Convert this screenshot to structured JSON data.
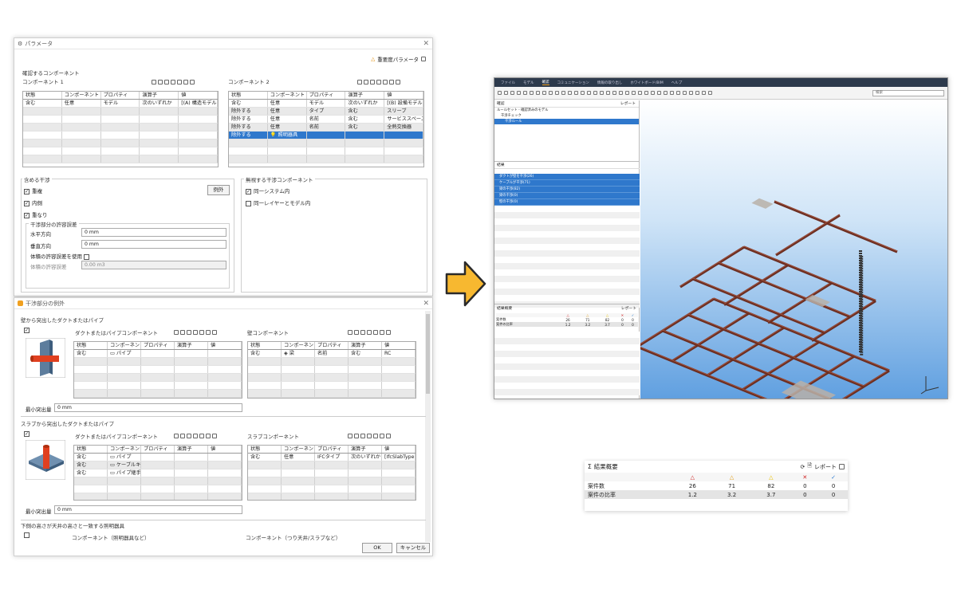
{
  "win1": {
    "title": "パラメータ",
    "priority_link": "重要度パラメータ",
    "sec_components": "確認するコンポーネント",
    "comp1_label": "コンポーネント 1",
    "comp2_label": "コンポーネント 2",
    "columns": [
      "状態",
      "コンポーネント",
      "プロパティ",
      "演算子",
      "値"
    ],
    "comp1_rows": [
      [
        "含む",
        "任意",
        "モデル",
        "次のいずれか",
        "[(A) 構造モデル]"
      ]
    ],
    "comp2_rows": [
      [
        "含む",
        "任意",
        "モデル",
        "次のいずれか",
        "[(B) 設備モデル]"
      ],
      [
        "除外する",
        "任意",
        "タイプ",
        "含む",
        "スリーブ"
      ],
      [
        "除外する",
        "任意",
        "名前",
        "含む",
        "サービススペース"
      ],
      [
        "除外する",
        "任意",
        "名前",
        "含む",
        "全熱交換器"
      ],
      [
        "除外する",
        "照明器具",
        "",
        "",
        ""
      ]
    ],
    "sec_interference": "含める干渉",
    "exception_button": "例外",
    "checks": [
      "重複",
      "内側",
      "重なり"
    ],
    "tolerance_group": "干渉部分の許容誤差",
    "horizontal_label": "水平方向",
    "horizontal_value": "0 mm",
    "vertical_label": "垂直方向",
    "vertical_value": "0 mm",
    "volume_check_label": "体積の許容誤差を使用",
    "volume_label": "体積の許容誤差",
    "volume_value": "0.00 m3",
    "sec_ignore": "無視する干渉コンポーネント",
    "ignore_checks": [
      "同一システム内",
      "同一レイヤーとモデル内"
    ]
  },
  "win2": {
    "title": "干渉部分の例外",
    "sec1": "壁から突出したダクトまたはパイプ",
    "duct_comp_label": "ダクトまたはパイプコンポーネント",
    "wall_comp_label": "壁コンポーネント",
    "columns": [
      "状態",
      "コンポーネント",
      "プロパティ",
      "演算子",
      "値"
    ],
    "duct_rows1": [
      [
        "含む",
        "パイプ",
        "",
        "",
        ""
      ]
    ],
    "wall_rows": [
      [
        "含む",
        "梁",
        "名前",
        "含む",
        "RC"
      ]
    ],
    "min_label": "最小突出量",
    "min_value": "0 mm",
    "sec2": "スラブから突出したダクトまたはパイプ",
    "slab_comp_label": "スラブコンポーネント",
    "duct_rows2": [
      [
        "含む",
        "パイプ",
        "",
        "",
        ""
      ],
      [
        "含む",
        "ケーブルキ...",
        "",
        "",
        ""
      ],
      [
        "含む",
        "パイプ継手",
        "",
        "",
        ""
      ]
    ],
    "slab_rows": [
      [
        "含む",
        "任意",
        "IFCタイプ",
        "次のいずれか",
        "[IfcSlabType]"
      ]
    ],
    "min_value2": "0 mm",
    "sec3": "下側の高さが天井の高さと一致する照明器具",
    "light_comp_label": "コンポーネント（照明器具など）",
    "ceiling_comp_label": "コンポーネント（つり天井/スラブなど）",
    "ok": "OK",
    "cancel": "キャンセル"
  },
  "app": {
    "menu": [
      "ファイル",
      "モデル",
      "確認",
      "コミュニケーション",
      "情報の取り出し",
      "ホワイトボード/BIM",
      "ヘルプ"
    ],
    "search_placeholder": "検索",
    "check_panel_title": "確認",
    "results_panel_title": "結果",
    "summary_panel_title": "結果概要",
    "report_label": "レポート",
    "tree_items": [
      "ルールセット - 確認済みのモデル",
      "干渉チェック",
      "干渉ルール"
    ],
    "result_items": [
      "ダクトが壁を干渉(26)",
      "ケーブルが干渉(71)",
      "梁の干渉(82)",
      "梁の干渉(0)",
      "壁の干渉(0)"
    ]
  },
  "summary": {
    "title": "結果概要",
    "report_label": "レポート",
    "rows": [
      {
        "label": "案件数",
        "values": [
          "26",
          "71",
          "82",
          "0",
          "0"
        ]
      },
      {
        "label": "案件の比率",
        "values": [
          "1.2",
          "3.2",
          "3.7",
          "0",
          "0"
        ]
      }
    ],
    "colors": {
      "critical": "#d03030",
      "major": "#e0a020",
      "minor": "#e8c000",
      "rejected": "#d02020",
      "approved": "#2a7ad0"
    }
  }
}
